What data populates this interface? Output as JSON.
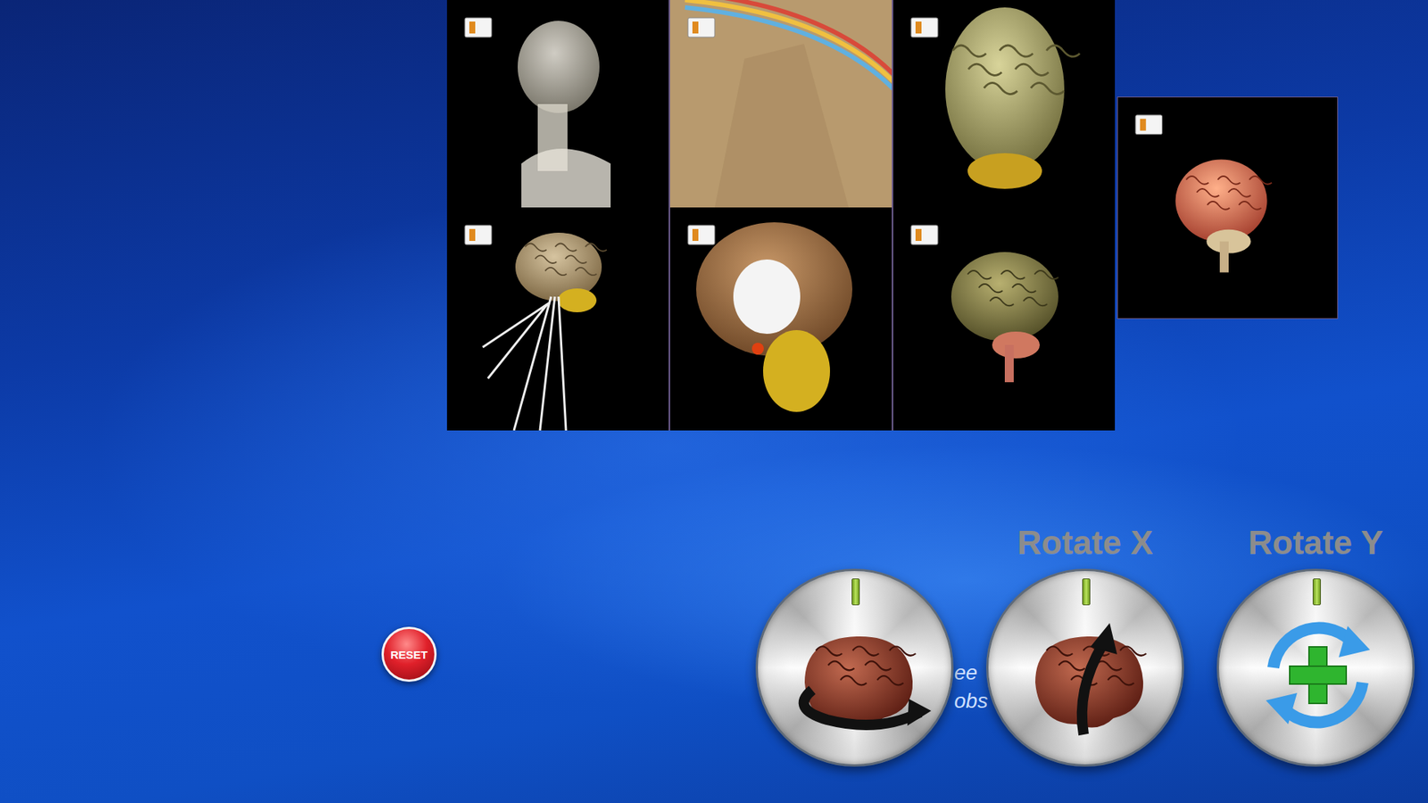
{
  "knobs": [
    {
      "kind": "spin"
    },
    {
      "kind": "tilt",
      "label": "Rotate X"
    },
    {
      "kind": "add",
      "label": "Rotate Y"
    }
  ],
  "hidden_caption": [
    "ee",
    "obs"
  ],
  "reset_button": {
    "label": "RESET"
  }
}
